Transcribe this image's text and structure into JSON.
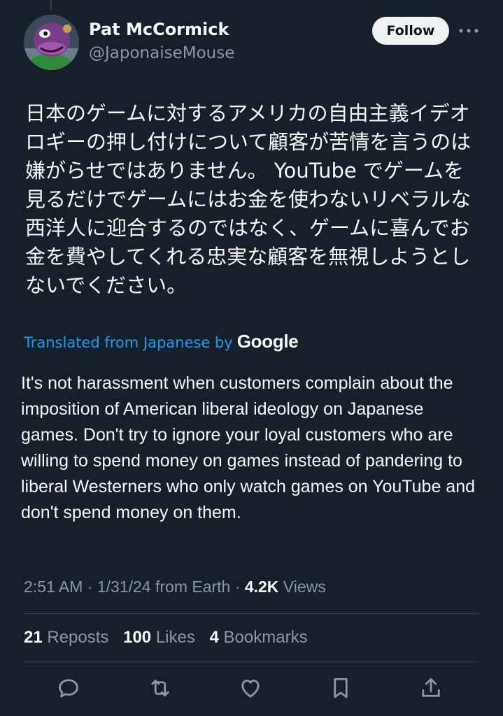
{
  "author": {
    "display_name": "Pat McCormick",
    "handle": "@JaponaiseMouse",
    "avatar_icon": "purple-dinosaur-avatar"
  },
  "follow_label": "Follow",
  "more_icon": "more-horizontal-icon",
  "tweet": {
    "original_text": "日本のゲームに対するアメリカの自由主義イデオロギーの押し付けについて顧客が苦情を言うのは嫌がらせではありません。 YouTube でゲームを見るだけでゲームにはお金を使わないリベラルな西洋人に迎合するのではなく、ゲームに喜んでお金を費やしてくれる忠実な顧客を無視しようとしないでください。",
    "translation_label": "Translated from Japanese by",
    "translation_provider": "Google",
    "translated_text": "It's not harassment when customers complain about the imposition of American liberal ideology on Japanese games. Don't try to ignore your loyal customers who are willing to spend money on games instead of pandering to liberal Westerners who only watch games on YouTube and don't spend money on them."
  },
  "meta": {
    "time": "2:51 AM",
    "date": "1/31/24",
    "location": "from Earth",
    "separator": "·",
    "views_count": "4.2K",
    "views_label": "Views"
  },
  "stats": {
    "reposts_count": "21",
    "reposts_label": "Reposts",
    "likes_count": "100",
    "likes_label": "Likes",
    "bookmarks_count": "4",
    "bookmarks_label": "Bookmarks"
  },
  "actions": [
    "reply-icon",
    "repost-icon",
    "like-icon",
    "bookmark-icon",
    "share-icon"
  ],
  "colors": {
    "background": "#15202b",
    "text": "#f7f9f9",
    "secondary": "#8b98a5",
    "link": "#1d9bf0",
    "divider": "#38444d",
    "follow_button": "#eff3f4"
  }
}
